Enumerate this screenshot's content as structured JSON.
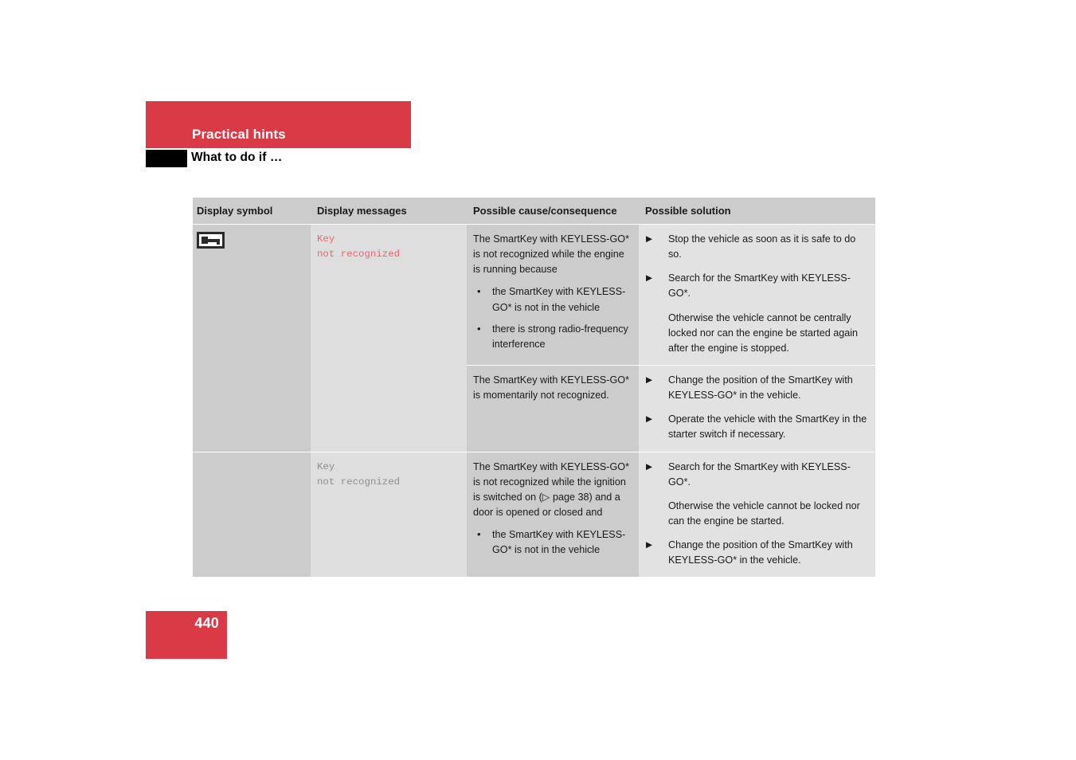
{
  "header": {
    "banner_title": "Practical hints",
    "subtitle": "What to do if …",
    "banner_color": "#d93a45",
    "black_box_color": "#000000"
  },
  "table": {
    "columns": [
      "Display symbol",
      "Display messages",
      "Possible cause/consequence",
      "Possible solution"
    ],
    "rows": [
      {
        "symbol_icon": "key-in-frame-icon",
        "display_message": "Key\nnot recognized",
        "display_message_color": "#e8666e",
        "cause_intro": "The SmartKey with KEYLESS-GO* is not recognized while the engine is running because",
        "cause_bullets": [
          "the SmartKey with KEYLESS-GO* is not in the vehicle",
          "there is strong radio-frequency interference"
        ],
        "solutions": [
          {
            "marker": "triangle",
            "text": "Stop the vehicle as soon as it is safe to do so."
          },
          {
            "marker": "triangle",
            "text": "Search for the SmartKey with KEYLESS-GO*."
          },
          {
            "marker": "none",
            "text": "Otherwise the vehicle cannot be centrally locked nor can the engine be started again after the engine is stopped."
          }
        ]
      },
      {
        "symbol_icon": "",
        "display_message": "",
        "cause_intro": "The SmartKey with KEYLESS-GO* is momentarily not recognized.",
        "cause_bullets": [],
        "solutions": [
          {
            "marker": "triangle",
            "text": "Change the position of the SmartKey with KEYLESS-GO* in the vehicle."
          },
          {
            "marker": "triangle",
            "text": "Operate the vehicle with the SmartKey in the starter switch if necessary."
          }
        ]
      },
      {
        "symbol_icon": "",
        "display_message": "Key\nnot recognized",
        "display_message_color": "#8f8f8f",
        "cause_intro": "The SmartKey with KEYLESS-GO* is not recognized while the ignition is switched on (▷ page 38) and a door is opened or closed and",
        "cause_bullets": [
          "the SmartKey with KEYLESS-GO* is not in the vehicle"
        ],
        "solutions": [
          {
            "marker": "triangle",
            "text": "Search for the SmartKey with KEYLESS-GO*."
          },
          {
            "marker": "none",
            "text": "Otherwise the vehicle cannot be locked nor can the engine be started."
          },
          {
            "marker": "triangle",
            "text": "Change the position of the SmartKey with KEYLESS-GO* in the vehicle."
          }
        ]
      }
    ]
  },
  "footer": {
    "page_number": "440",
    "page_box_color": "#d93a45"
  }
}
